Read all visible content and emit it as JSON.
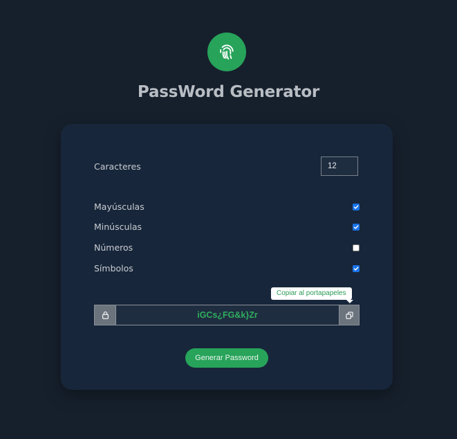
{
  "app": {
    "title": "PassWord Generator",
    "logo_icon": "fingerprint-icon",
    "accent_color": "#27a35a"
  },
  "settings": {
    "length_label": "Caracteres",
    "length_value": "12",
    "options": [
      {
        "label": "Mayúsculas",
        "checked": true
      },
      {
        "label": "Minúsculas",
        "checked": true
      },
      {
        "label": "Números",
        "checked": false
      },
      {
        "label": "Símbolos",
        "checked": true
      }
    ]
  },
  "output": {
    "lock_icon": "lock-icon",
    "password": "iGCs¿FG&k}Zr",
    "copy_icon": "copy-icon",
    "copy_tooltip": "Copiar al portapapeles"
  },
  "actions": {
    "generate_label": "Generar Password"
  }
}
